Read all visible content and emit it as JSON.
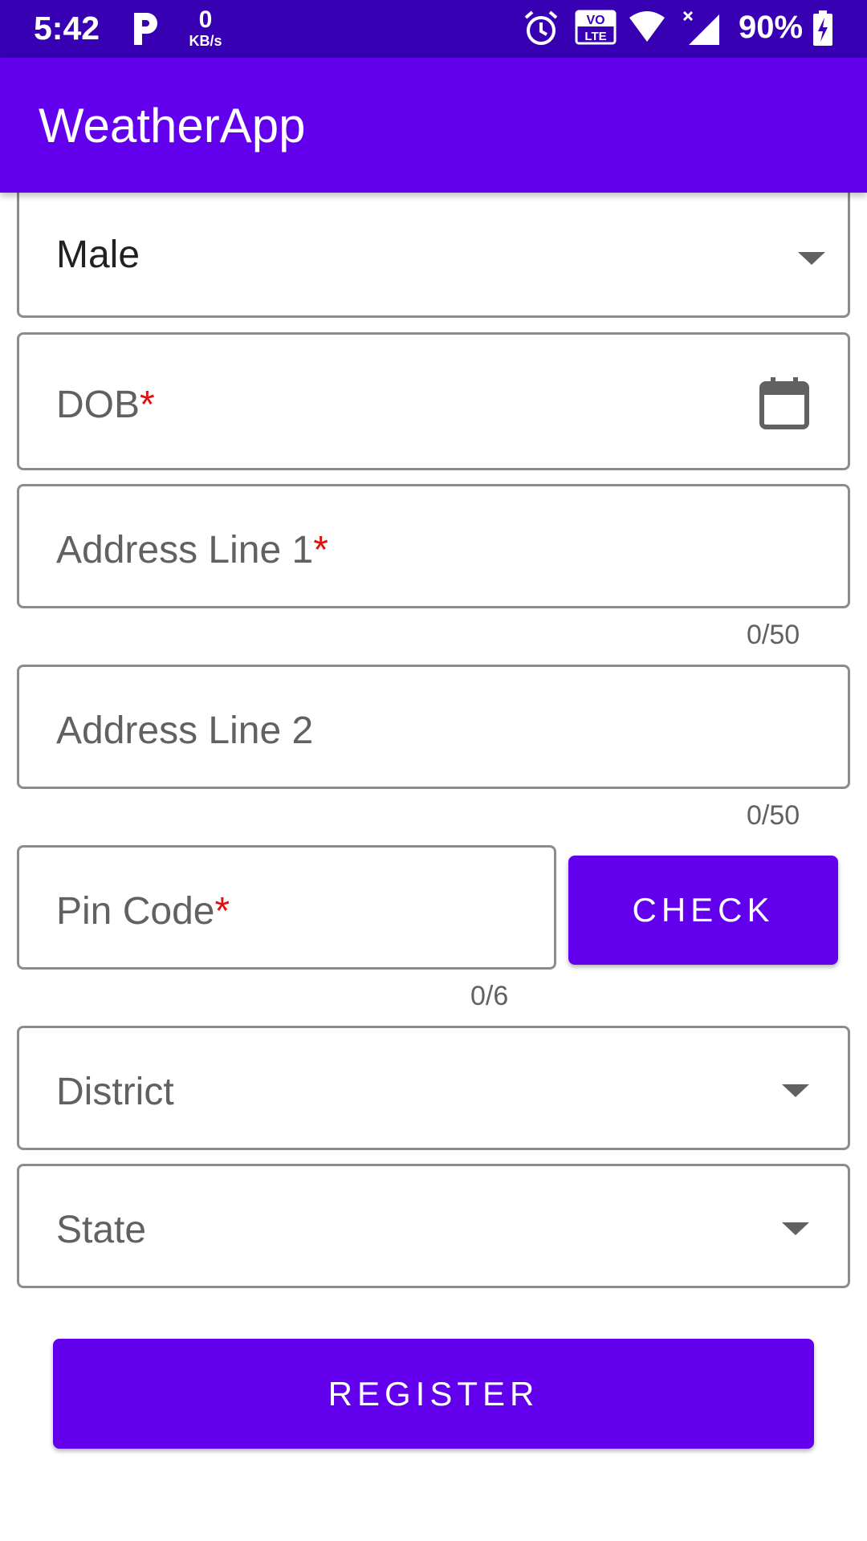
{
  "status_bar": {
    "time": "5:42",
    "net_speed_value": "0",
    "net_speed_unit": "KB/s",
    "volte": "VO",
    "lte": "LTE",
    "battery_percent": "90%"
  },
  "app_bar": {
    "title": "WeatherApp"
  },
  "form": {
    "gender": {
      "value": "Male"
    },
    "dob": {
      "label": "DOB",
      "required_mark": "*"
    },
    "address1": {
      "label": "Address Line 1",
      "required_mark": "*",
      "counter": "0/50"
    },
    "address2": {
      "label": "Address Line 2",
      "counter": "0/50"
    },
    "pincode": {
      "label": "Pin Code",
      "required_mark": "*",
      "counter": "0/6"
    },
    "check_button": "CHECK",
    "district": {
      "label": "District"
    },
    "state": {
      "label": "State"
    },
    "register_button": "REGISTER"
  },
  "colors": {
    "status_bar": "#3700b3",
    "primary": "#6200ee",
    "required": "#e01010"
  }
}
